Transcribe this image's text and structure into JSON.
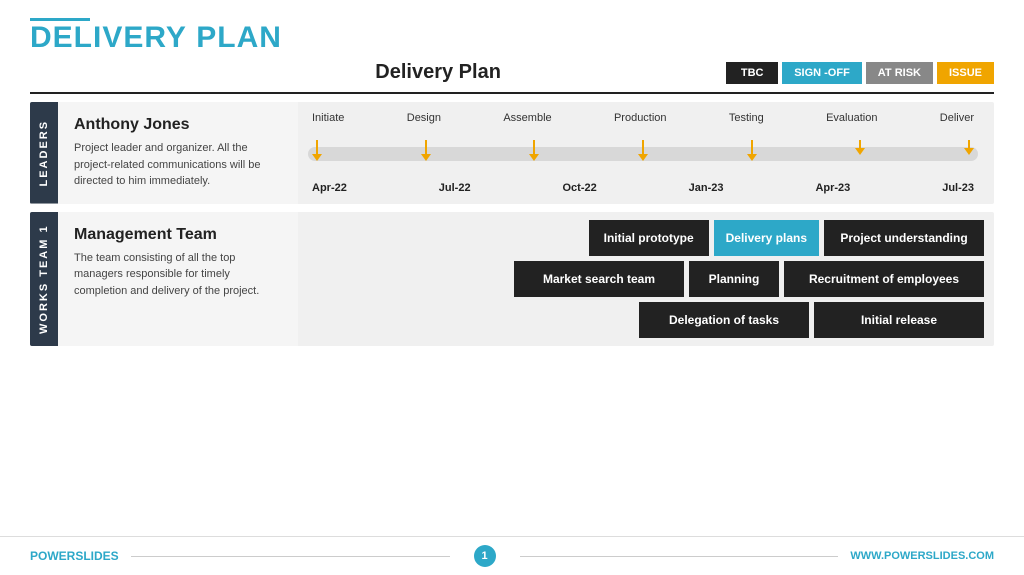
{
  "header": {
    "accent_line": true,
    "title_plain": "DELIVERY",
    "title_colored": "PLAN",
    "accent_color": "#2da8c8"
  },
  "subtitle_bar": {
    "title": "Delivery Plan",
    "badges": [
      {
        "label": "TBC",
        "class": "badge-tbc"
      },
      {
        "label": "SIGN -OFF",
        "class": "badge-signoff"
      },
      {
        "label": "AT RISK",
        "class": "badge-atrisk"
      },
      {
        "label": "ISSUE",
        "class": "badge-issue"
      }
    ]
  },
  "leaders_section": {
    "sidebar_label": "LEADERS",
    "person_name": "Anthony Jones",
    "person_desc": "Project leader and organizer. All the project-related communications will be directed to him immediately.",
    "phases": [
      "Initiate",
      "Design",
      "Assemble",
      "Production",
      "Testing",
      "Evaluation",
      "Deliver"
    ],
    "dates": [
      "Apr-22",
      "Jul-22",
      "Oct-22",
      "Jan-23",
      "Apr-23",
      "Jul-23"
    ]
  },
  "works_section": {
    "sidebar_label": "WORKS TEAM 1",
    "team_name": "Management Team",
    "team_desc": "The team consisting of all the top managers responsible for timely completion and delivery of the project.",
    "task_rows": [
      [
        {
          "label": "Initial prototype",
          "class": "task-dark"
        },
        {
          "label": "Delivery plans",
          "class": "task-blue"
        },
        {
          "label": "Project understanding",
          "class": "task-dark"
        }
      ],
      [
        {
          "label": "Market search team",
          "class": "task-dark"
        },
        {
          "label": "Planning",
          "class": "task-dark"
        },
        {
          "label": "Recruitment of employees",
          "class": "task-dark"
        }
      ],
      [
        {
          "label": "Delegation of tasks",
          "class": "task-dark"
        },
        {
          "label": "Initial release",
          "class": "task-dark"
        }
      ]
    ]
  },
  "footer": {
    "brand_plain": "POWER",
    "brand_colored": "SLIDES",
    "page_number": "1",
    "website": "WWW.POWERSLIDES.COM"
  }
}
